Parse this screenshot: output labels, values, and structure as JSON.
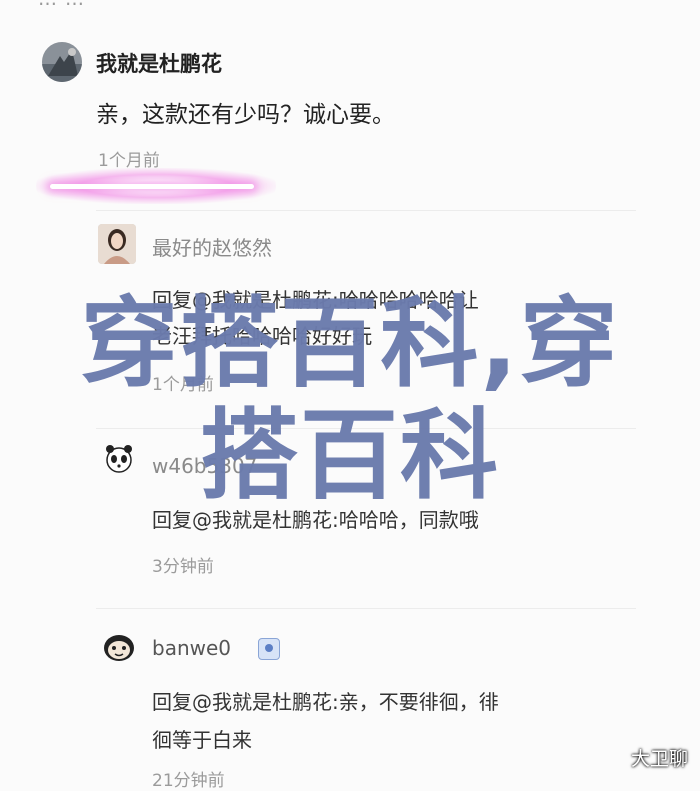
{
  "top_fragment": "…  …",
  "comments": [
    {
      "username": "我就是杜鹏花",
      "text": "亲，这款还有少吗？诚心要。",
      "time": "1个月前"
    }
  ],
  "replies": [
    {
      "username": "最好的赵悠然",
      "text_line1": "回复@我就是杜鹏花:哈哈哈哈哈哈让",
      "text_line2": "老汪拜托哈哈哈哈好好玩",
      "time": "1个月前"
    },
    {
      "username": "w46b5307",
      "text_line1": "回复@我就是杜鹏花:哈哈哈，同款哦",
      "time": "3分钟前"
    },
    {
      "username": "banwe0",
      "text_line1": "回复@我就是杜鹏花:亲，不要徘徊，徘",
      "text_line2": "徊等于白来",
      "time": "21分钟前"
    }
  ],
  "watermark": {
    "line1": "穿搭百科,穿",
    "line2": "搭百科",
    "color": "#6b7bad"
  },
  "logo": "大卫聊",
  "highlight_color": "#f08ce6"
}
